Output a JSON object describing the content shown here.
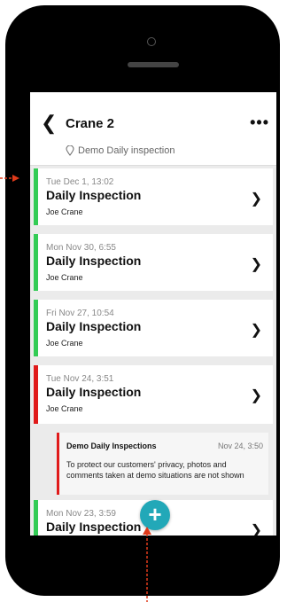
{
  "header": {
    "back_icon": "chevron-left-icon",
    "title": "Crane 2",
    "more_icon": "ellipsis-icon",
    "location": "Demo Daily inspection"
  },
  "inspections": [
    {
      "time": "Tue Dec 1, 13:02",
      "name": "Daily Inspection",
      "user": "Joe Crane",
      "status": "green"
    },
    {
      "time": "Mon Nov 30, 6:55",
      "name": "Daily Inspection",
      "user": "Joe Crane",
      "status": "green"
    },
    {
      "time": "Fri Nov 27, 10:54",
      "name": "Daily Inspection",
      "user": "Joe Crane",
      "status": "green"
    },
    {
      "time": "Tue Nov 24, 3:51",
      "name": "Daily Inspection",
      "user": "Joe Crane",
      "status": "red"
    },
    {
      "time": "Mon Nov 23, 3:59",
      "name": "Daily Inspection",
      "user": "",
      "status": "green"
    }
  ],
  "note": {
    "title": "Demo Daily Inspections",
    "time": "Nov 24, 3:50",
    "body": "To protect our customers' privacy, photos and comments taken at demo situations are not shown"
  },
  "fab": {
    "label": "+"
  },
  "colors": {
    "green": "#33cc55",
    "red": "#e01a1a",
    "accent": "#22a8b8",
    "annotation": "#e03a1a"
  }
}
